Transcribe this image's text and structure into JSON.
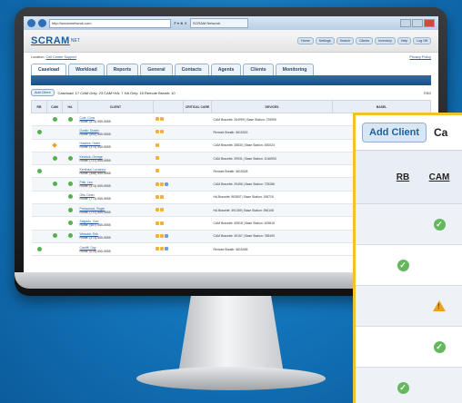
{
  "browser": {
    "url": "http://scramnetwork.com",
    "search_hint": "ℙ ▾ ⊗ ✕",
    "tab_title": "SCRAM Network"
  },
  "header": {
    "logo": "SCRAM",
    "logo_suffix": "NET",
    "links": [
      "Home",
      "Settings",
      "Search",
      "Clients",
      "Inventory",
      "Help",
      "Log Off"
    ]
  },
  "location": {
    "label": "Location:",
    "value": "Cell Center Support",
    "right_link": "Privacy Policy"
  },
  "tabs": [
    "Caseload",
    "Workload",
    "Reports",
    "General",
    "Contacts",
    "Agents",
    "Clients",
    "Monitoring"
  ],
  "counts": {
    "add_client": "Add Client",
    "text": "Caseload: 17  CAM Only: 23  CAM+HA: 7  HA Only: 15  Remote Breath: 10",
    "flag": "RBB"
  },
  "table": {
    "headers": [
      "RB",
      "CAM",
      "HA",
      "CLIENT",
      "",
      "CRITICAL CARE",
      "DEVICES",
      "BASEL"
    ],
    "rows": [
      {
        "rb": "",
        "cam": "ok",
        "ha": "ok",
        "name": "Cole, Cora",
        "phone": "Home: (874) 555-5555",
        "icons": 2,
        "devices": "CAM Bracelet: 264999 | Base Station: 725999"
      },
      {
        "rb": "ok",
        "cam": "",
        "ha": "",
        "name": "Dunlin, Dustin",
        "phone": "Home: (892) 555-5555",
        "icons": 2,
        "devices": "Remote Breath: 5615315"
      },
      {
        "rb": "",
        "cam": "warn",
        "ha": "",
        "name": "Hawkes, Helen",
        "phone": "Home: (474) 555-5555",
        "icons": 1,
        "devices": "CAM Bracelet: 28830 | Base Station: 450024"
      },
      {
        "rb": "",
        "cam": "ok",
        "ha": "ok",
        "name": "Kennick, George",
        "phone": "Home: (737) 555-5555",
        "icons": 1,
        "devices": "CAM Bracelet: 29931 | Base Station: 1046953"
      },
      {
        "rb": "ok",
        "cam": "",
        "ha": "",
        "name": "Kershaw, Lucianna",
        "phone": "Home: (488) 555-5555",
        "icons": 1,
        "devices": "Remote Breath: 5615328"
      },
      {
        "rb": "",
        "cam": "ok",
        "ha": "ok",
        "name": "Polk, Leo",
        "phone": "Home: (474) 555-5555",
        "icons": 3,
        "devices": "CAM Bracelet: 29496 | Base Station: 725286"
      },
      {
        "rb": "",
        "cam": "",
        "ha": "ok",
        "name": "Otis, Dean",
        "phone": "Home: (773) 555-5555",
        "icons": 2,
        "devices": "HA Bracelet: 963807 | Base Station: 198715"
      },
      {
        "rb": "",
        "cam": "",
        "ha": "ok",
        "name": "Presswood, Roger",
        "phone": "Home: (737) 555-5555",
        "icons": 2,
        "devices": "HA Bracelet: 391359 | Base Station: 396108"
      },
      {
        "rb": "",
        "cam": "",
        "ha": "ok",
        "name": "Salgado, Xavi",
        "phone": "Home: (687) 555-5555",
        "icons": 2,
        "devices": "CAM Bracelet: 49518 | Base Station: 529816"
      },
      {
        "rb": "",
        "cam": "ok",
        "ha": "ok",
        "name": "Wessick, Erik",
        "phone": "Home: (473) 555-5555",
        "icons": 3,
        "devices": "CAM Bracelet: 49157 | Base Station: 785409"
      },
      {
        "rb": "ok",
        "cam": "",
        "ha": "",
        "name": "Cardiff, Gay",
        "phone": "Home: (678) 555-5555",
        "icons": 3,
        "devices": "Remote Breath: 5615348"
      }
    ]
  },
  "zoom": {
    "button": "Add Client",
    "caseload_prefix": "Ca",
    "col_rb": "RB",
    "col_cam": "CAM",
    "rows": [
      {
        "rb": "",
        "cam": "ok"
      },
      {
        "rb": "ok",
        "cam": ""
      },
      {
        "rb": "",
        "cam": "warn"
      },
      {
        "rb": "",
        "cam": "ok"
      },
      {
        "rb": "ok",
        "cam": ""
      }
    ]
  },
  "colors": {
    "accent_blue": "#1d5d98",
    "status_ok": "#55b04f",
    "status_warn": "#f0a020",
    "callout_border": "#f2c12e"
  }
}
